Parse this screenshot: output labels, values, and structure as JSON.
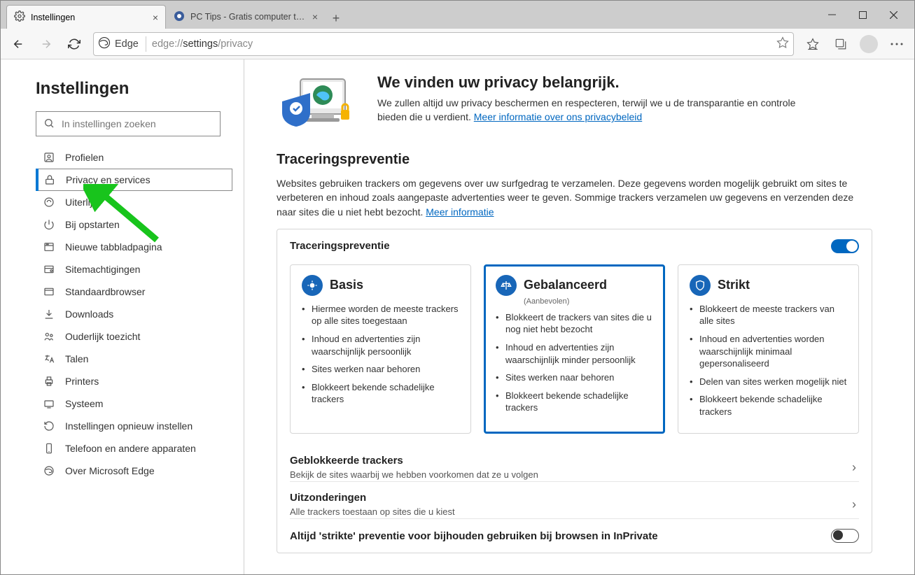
{
  "tabs": {
    "active": {
      "title": "Instellingen"
    },
    "inactive": {
      "title": "PC Tips - Gratis computer tips! -"
    }
  },
  "toolbar": {
    "edge_label": "Edge",
    "url_prefix": "edge://",
    "url_bold": "settings",
    "url_suffix": "/privacy"
  },
  "sidebar": {
    "heading": "Instellingen",
    "search_placeholder": "In instellingen zoeken",
    "items": [
      {
        "label": "Profielen"
      },
      {
        "label": "Privacy en services"
      },
      {
        "label": "Uiterlijk"
      },
      {
        "label": "Bij opstarten"
      },
      {
        "label": "Nieuwe tabbladpagina"
      },
      {
        "label": "Sitemachtigingen"
      },
      {
        "label": "Standaardbrowser"
      },
      {
        "label": "Downloads"
      },
      {
        "label": "Ouderlijk toezicht"
      },
      {
        "label": "Talen"
      },
      {
        "label": "Printers"
      },
      {
        "label": "Systeem"
      },
      {
        "label": "Instellingen opnieuw instellen"
      },
      {
        "label": "Telefoon en andere apparaten"
      },
      {
        "label": "Over Microsoft Edge"
      }
    ]
  },
  "hero": {
    "title": "We vinden uw privacy belangrijk.",
    "text": "We zullen altijd uw privacy beschermen en respecteren, terwijl we u de transparantie en controle bieden die u verdient. ",
    "link": "Meer informatie over ons privacybeleid"
  },
  "tracking": {
    "title": "Traceringspreventie",
    "description": "Websites gebruiken trackers om gegevens over uw surfgedrag te verzamelen. Deze gegevens worden mogelijk gebruikt om sites te verbeteren en inhoud zoals aangepaste advertenties weer te geven. Sommige trackers verzamelen uw gegevens en verzenden deze naar sites die u niet hebt bezocht. ",
    "more_info": "Meer informatie",
    "toggle_label": "Traceringspreventie",
    "levels": {
      "basic": {
        "title": "Basis",
        "points": [
          "Hiermee worden de meeste trackers op alle sites toegestaan",
          "Inhoud en advertenties zijn waarschijnlijk persoonlijk",
          "Sites werken naar behoren",
          "Blokkeert bekende schadelijke trackers"
        ]
      },
      "balanced": {
        "title": "Gebalanceerd",
        "recommended": "(Aanbevolen)",
        "points": [
          "Blokkeert de trackers van sites die u nog niet hebt bezocht",
          "Inhoud en advertenties zijn waarschijnlijk minder persoonlijk",
          "Sites werken naar behoren",
          "Blokkeert bekende schadelijke trackers"
        ]
      },
      "strict": {
        "title": "Strikt",
        "points": [
          "Blokkeert de meeste trackers van alle sites",
          "Inhoud en advertenties worden waarschijnlijk minimaal gepersonaliseerd",
          "Delen van sites werken mogelijk niet",
          "Blokkeert bekende schadelijke trackers"
        ]
      }
    },
    "blocked": {
      "title": "Geblokkeerde trackers",
      "sub": "Bekijk de sites waarbij we hebben voorkomen dat ze u volgen"
    },
    "exceptions": {
      "title": "Uitzonderingen",
      "sub": "Alle trackers toestaan op sites die u kiest"
    },
    "inprivate": "Altijd 'strikte' preventie voor bijhouden gebruiken bij browsen in InPrivate"
  }
}
